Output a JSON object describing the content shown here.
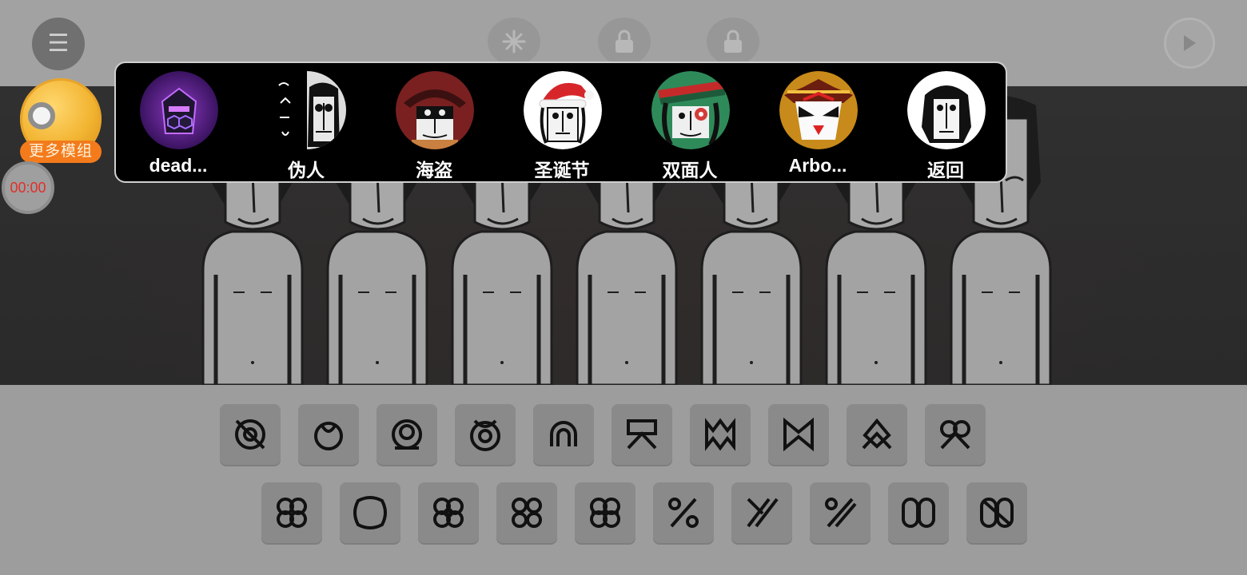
{
  "top_bar": {
    "menu_icon": "hamburger-menu-icon",
    "icons": [
      "randomize-icon",
      "lock-icon",
      "lock-icon"
    ],
    "play_icon": "play-icon"
  },
  "left_panel": {
    "more_mods_label": "更多模组",
    "timer": "00:00",
    "timer_color": "#e0302a"
  },
  "mod_panel": {
    "items": [
      {
        "label": "dead...",
        "theme": "purple"
      },
      {
        "label": "伪人",
        "theme": "black-white"
      },
      {
        "label": "海盗",
        "theme": "pirate"
      },
      {
        "label": "圣诞节",
        "theme": "christmas"
      },
      {
        "label": "双面人",
        "theme": "green"
      },
      {
        "label": "Arbo...",
        "theme": "gold"
      },
      {
        "label": "返回",
        "theme": "white"
      }
    ]
  },
  "stage": {
    "character_count": 7
  },
  "sound_bar": {
    "row1": [
      "sound-icon-1",
      "sound-icon-2",
      "sound-icon-3",
      "sound-icon-4",
      "sound-icon-5",
      "sound-icon-6",
      "sound-icon-7",
      "sound-icon-8",
      "sound-icon-9",
      "sound-icon-10"
    ],
    "row2": [
      "sound-icon-11",
      "sound-icon-12",
      "sound-icon-13",
      "sound-icon-14",
      "sound-icon-15",
      "sound-icon-16",
      "sound-icon-17",
      "sound-icon-18",
      "sound-icon-19",
      "sound-icon-20"
    ]
  },
  "colors": {
    "panel_bg": "#000000",
    "accent_orange": "#f37b1c",
    "coin_gold": "#f2b431"
  }
}
